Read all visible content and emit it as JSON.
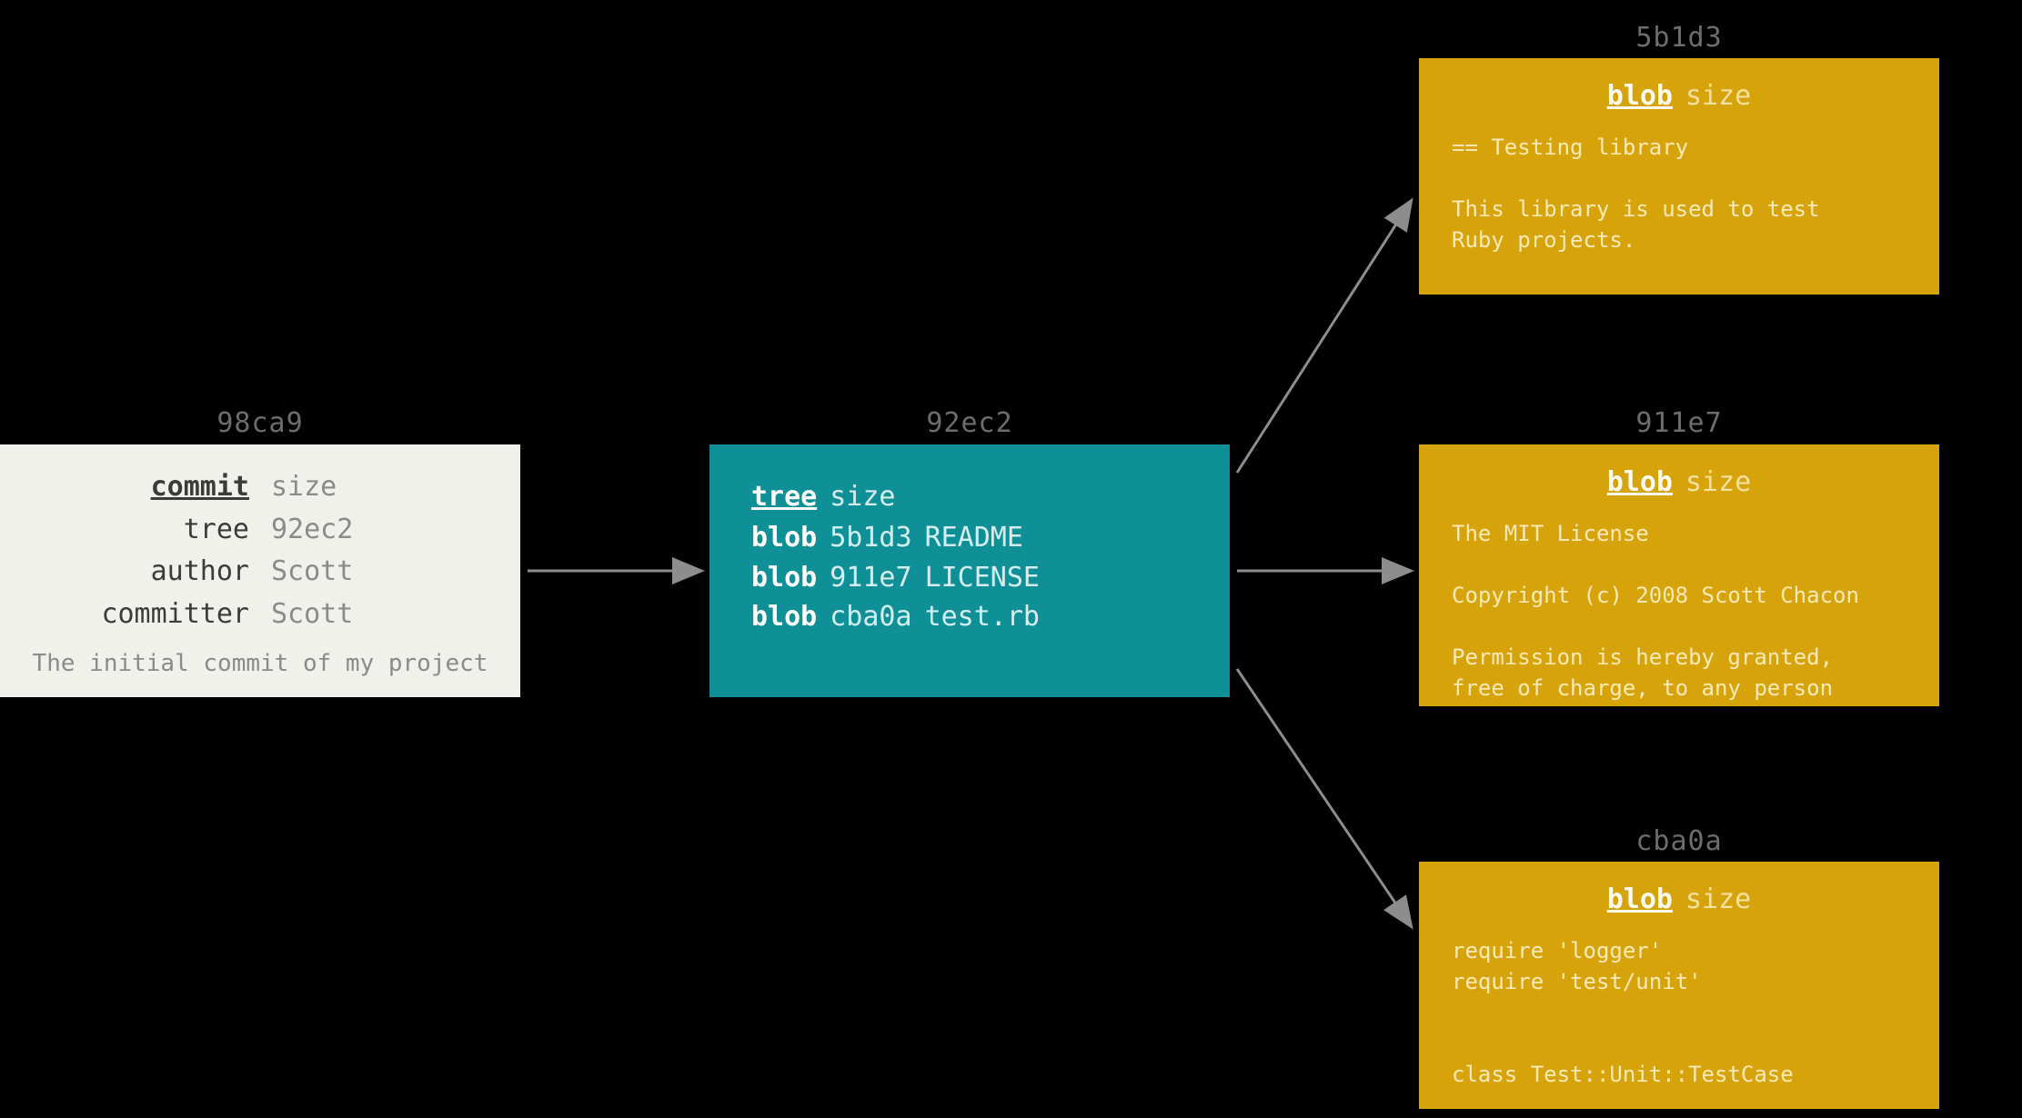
{
  "commit": {
    "hash": "98ca9",
    "type_label": "commit",
    "size_label": "size",
    "fields": {
      "tree_key": "tree",
      "tree_value": "92ec2",
      "author_key": "author",
      "author_value": "Scott",
      "committer_key": "committer",
      "committer_value": "Scott"
    },
    "message": "The initial commit of my project"
  },
  "tree": {
    "hash": "92ec2",
    "type_label": "tree",
    "size_label": "size",
    "entries": [
      {
        "type": "blob",
        "sha": "5b1d3",
        "name": "README"
      },
      {
        "type": "blob",
        "sha": "911e7",
        "name": "LICENSE"
      },
      {
        "type": "blob",
        "sha": "cba0a",
        "name": "test.rb"
      }
    ]
  },
  "blobs": [
    {
      "hash": "5b1d3",
      "type_label": "blob",
      "size_label": "size",
      "content": "== Testing library\n\nThis library is used to test\nRuby projects."
    },
    {
      "hash": "911e7",
      "type_label": "blob",
      "size_label": "size",
      "content": "The MIT License\n\nCopyright (c) 2008 Scott Chacon\n\nPermission is hereby granted,\nfree of charge, to any person"
    },
    {
      "hash": "cba0a",
      "type_label": "blob",
      "size_label": "size",
      "content": "require 'logger'\nrequire 'test/unit'\n\n\nclass Test::Unit::TestCase"
    }
  ],
  "colors": {
    "commit_bg": "#f1f1ec",
    "tree_bg": "#0f8f96",
    "blob_bg": "#d6a40a",
    "arrow": "#8d8d8d"
  }
}
